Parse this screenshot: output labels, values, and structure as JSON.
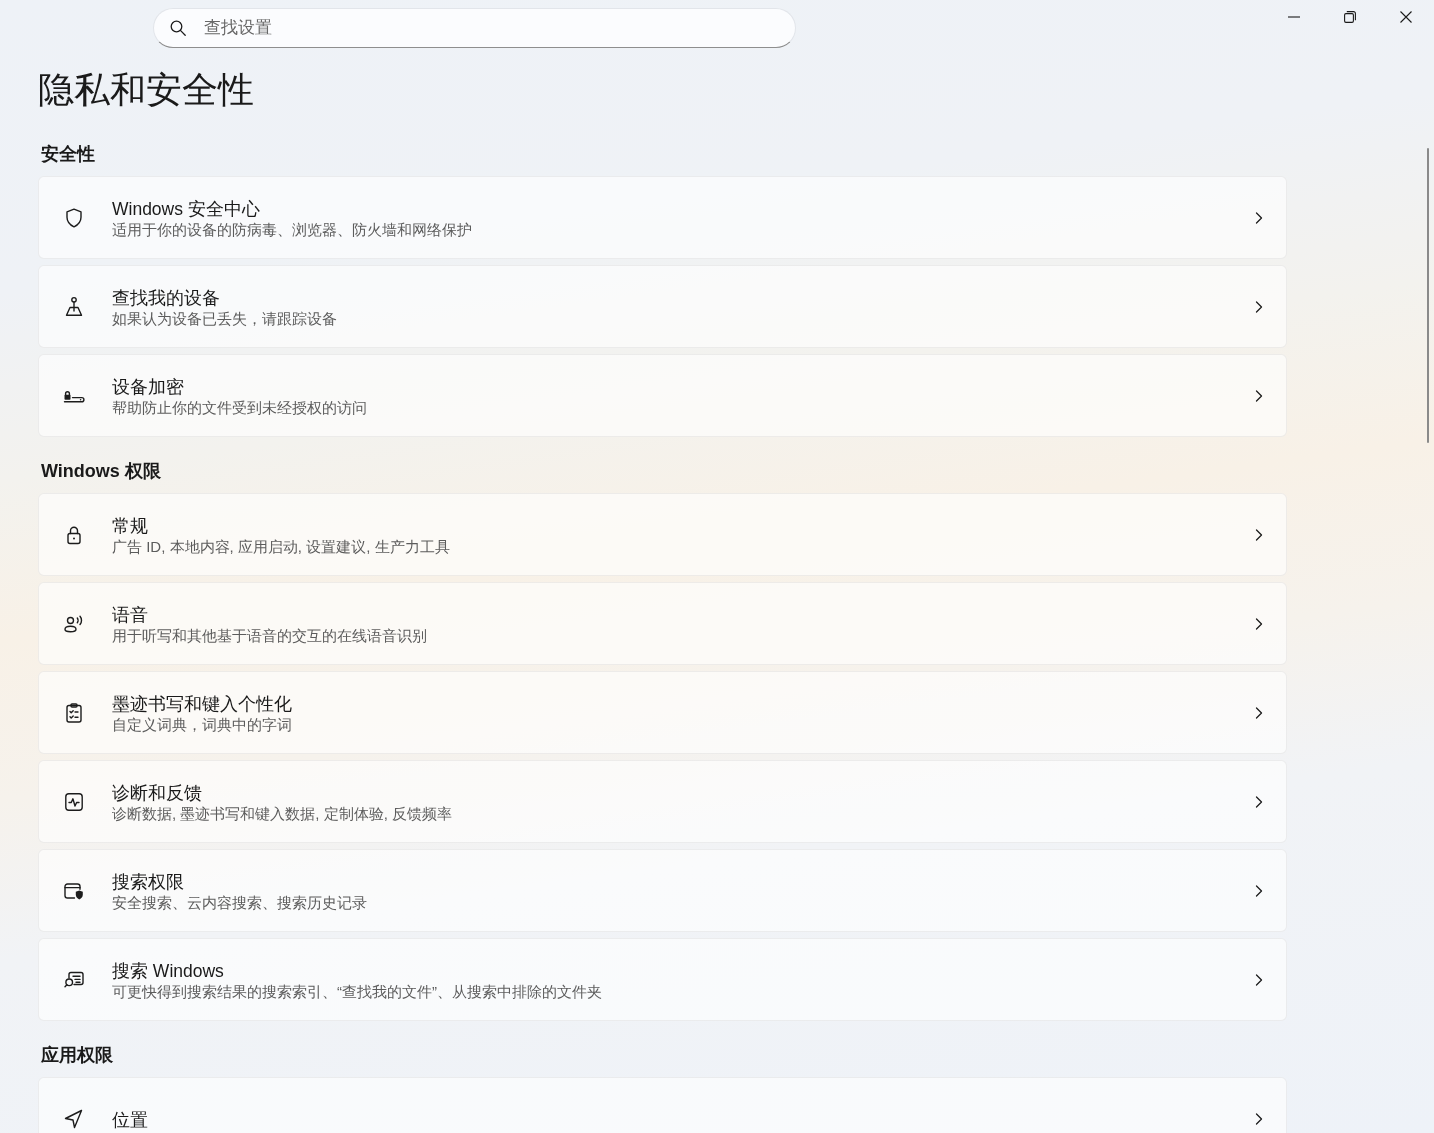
{
  "search": {
    "placeholder": "查找设置"
  },
  "page": {
    "title": "隐私和安全性"
  },
  "sections": [
    {
      "heading": "安全性",
      "items": [
        {
          "kind": "security",
          "title": "Windows 安全中心",
          "description": "适用于你的设备的防病毒、浏览器、防火墙和网络保护"
        },
        {
          "kind": "locate",
          "title": "查找我的设备",
          "description": "如果认为设备已丢失，请跟踪设备"
        },
        {
          "kind": "encryption",
          "title": "设备加密",
          "description": "帮助防止你的文件受到未经授权的访问"
        }
      ]
    },
    {
      "heading": "Windows 权限",
      "items": [
        {
          "kind": "general",
          "title": "常规",
          "description": "广告 ID, 本地内容, 应用启动, 设置建议, 生产力工具"
        },
        {
          "kind": "speech",
          "title": "语音",
          "description": "用于听写和其他基于语音的交互的在线语音识别"
        },
        {
          "kind": "inking",
          "title": "墨迹书写和键入个性化",
          "description": "自定义词典，词典中的字词"
        },
        {
          "kind": "diagnostics",
          "title": "诊断和反馈",
          "description": "诊断数据, 墨迹书写和键入数据, 定制体验, 反馈频率"
        },
        {
          "kind": "permissions",
          "title": "搜索权限",
          "description": "安全搜索、云内容搜索、搜索历史记录"
        },
        {
          "kind": "indexing",
          "title": "搜索 Windows",
          "description": "可更快得到搜索结果的搜索索引、“查找我的文件”、从搜索中排除的文件夹"
        }
      ]
    },
    {
      "heading": "应用权限",
      "items": [
        {
          "kind": "location",
          "title": "位置"
        }
      ]
    }
  ]
}
